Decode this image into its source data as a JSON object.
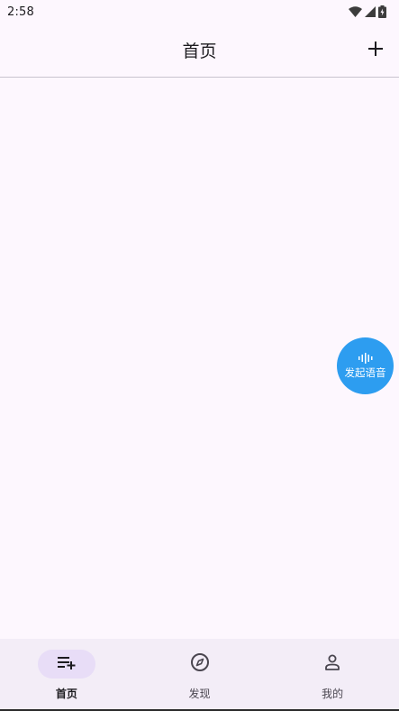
{
  "status_bar": {
    "time": "2:58",
    "icons": [
      "wifi-icon",
      "signal-icon",
      "battery-icon"
    ]
  },
  "app_bar": {
    "title": "首页",
    "action_icon": "plus-icon"
  },
  "voice_fab": {
    "label": "发起语音",
    "icon": "voice-wave-icon",
    "color": "#2d9df0"
  },
  "bottom_nav": {
    "items": [
      {
        "label": "首页",
        "icon": "playlist-add-icon",
        "active": true
      },
      {
        "label": "发现",
        "icon": "compass-icon",
        "active": false
      },
      {
        "label": "我的",
        "icon": "person-icon",
        "active": false
      }
    ]
  },
  "colors": {
    "background": "#fdf7fe",
    "nav_background": "#f3edf7",
    "active_indicator": "#e8ddf7"
  }
}
